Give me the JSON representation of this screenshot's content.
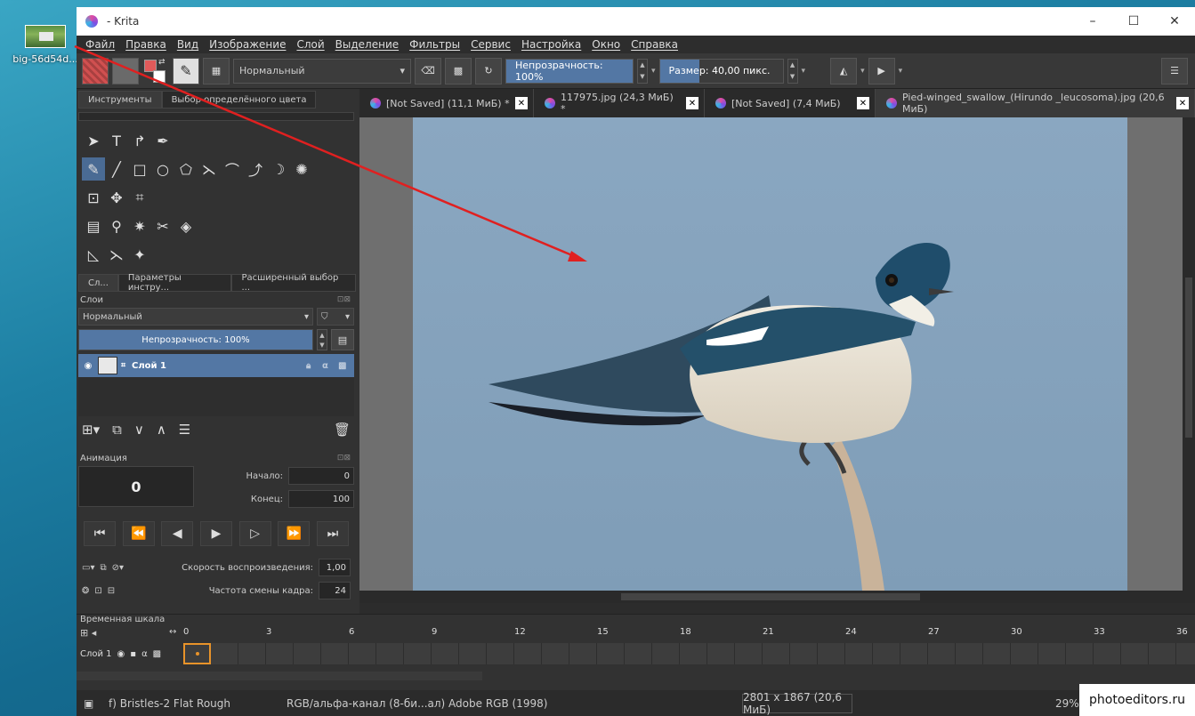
{
  "desktop": {
    "icon_label": "big-56d54d..."
  },
  "window": {
    "title": "- Krita",
    "minimize": "–",
    "maximize": "☐",
    "close": "✕"
  },
  "menu": [
    "Файл",
    "Правка",
    "Вид",
    "Изображение",
    "Слой",
    "Выделение",
    "Фильтры",
    "Сервис",
    "Настройка",
    "Окно",
    "Справка"
  ],
  "toolbar": {
    "blend_mode": "Нормальный",
    "opacity_label": "Непрозрачность: 100%",
    "opacity_value": 1.0,
    "size_label": "Размер: 40,00 пикс.",
    "fg_color": "#e05a5a",
    "bg_color": "#ffffff"
  },
  "left_tabs": {
    "tools": "Инструменты",
    "color_select": "Выбор определённого цвета"
  },
  "panel_tabs": {
    "layers": "Сл...",
    "tool_options": "Параметры инстру...",
    "advanced": "Расширенный выбор ..."
  },
  "layers": {
    "title": "Слои",
    "blend_mode": "Нормальный",
    "opacity": "Непрозрачность:  100%",
    "layer_name": "Слой 1"
  },
  "animation": {
    "title": "Анимация",
    "current_frame": "0",
    "start_label": "Начало:",
    "start_value": "0",
    "end_label": "Конец:",
    "end_value": "100",
    "speed_label": "Скорость воспроизведения:",
    "speed_value": "1,00",
    "fps_label": "Частота смены кадра:",
    "fps_value": "24"
  },
  "document_tabs": [
    {
      "name": "[Not Saved]  (11,1 МиБ) *"
    },
    {
      "name": "117975.jpg (24,3 МиБ) *"
    },
    {
      "name": "[Not Saved]  (7,4 МиБ)"
    },
    {
      "name": "Pied-winged_swallow_(Hirundo _leucosoma).jpg (20,6 МиБ)"
    }
  ],
  "timeline": {
    "title": "Временная шкала",
    "layer_name": "Слой 1",
    "ticks": [
      "0",
      "3",
      "6",
      "9",
      "12",
      "15",
      "18",
      "21",
      "24",
      "27",
      "30",
      "33",
      "36"
    ]
  },
  "status": {
    "brush": "f) Bristles-2 Flat Rough",
    "color_space": "RGB/альфа-канал (8-би...ал)  Adobe RGB (1998)",
    "image_size": "2801 x 1867 (20,6 МиБ)",
    "zoom": "29%"
  },
  "watermark": "photoeditors.ru",
  "colors": {
    "accent": "#5377a4",
    "sky": "#86a3bd",
    "arrow": "#e02020"
  }
}
